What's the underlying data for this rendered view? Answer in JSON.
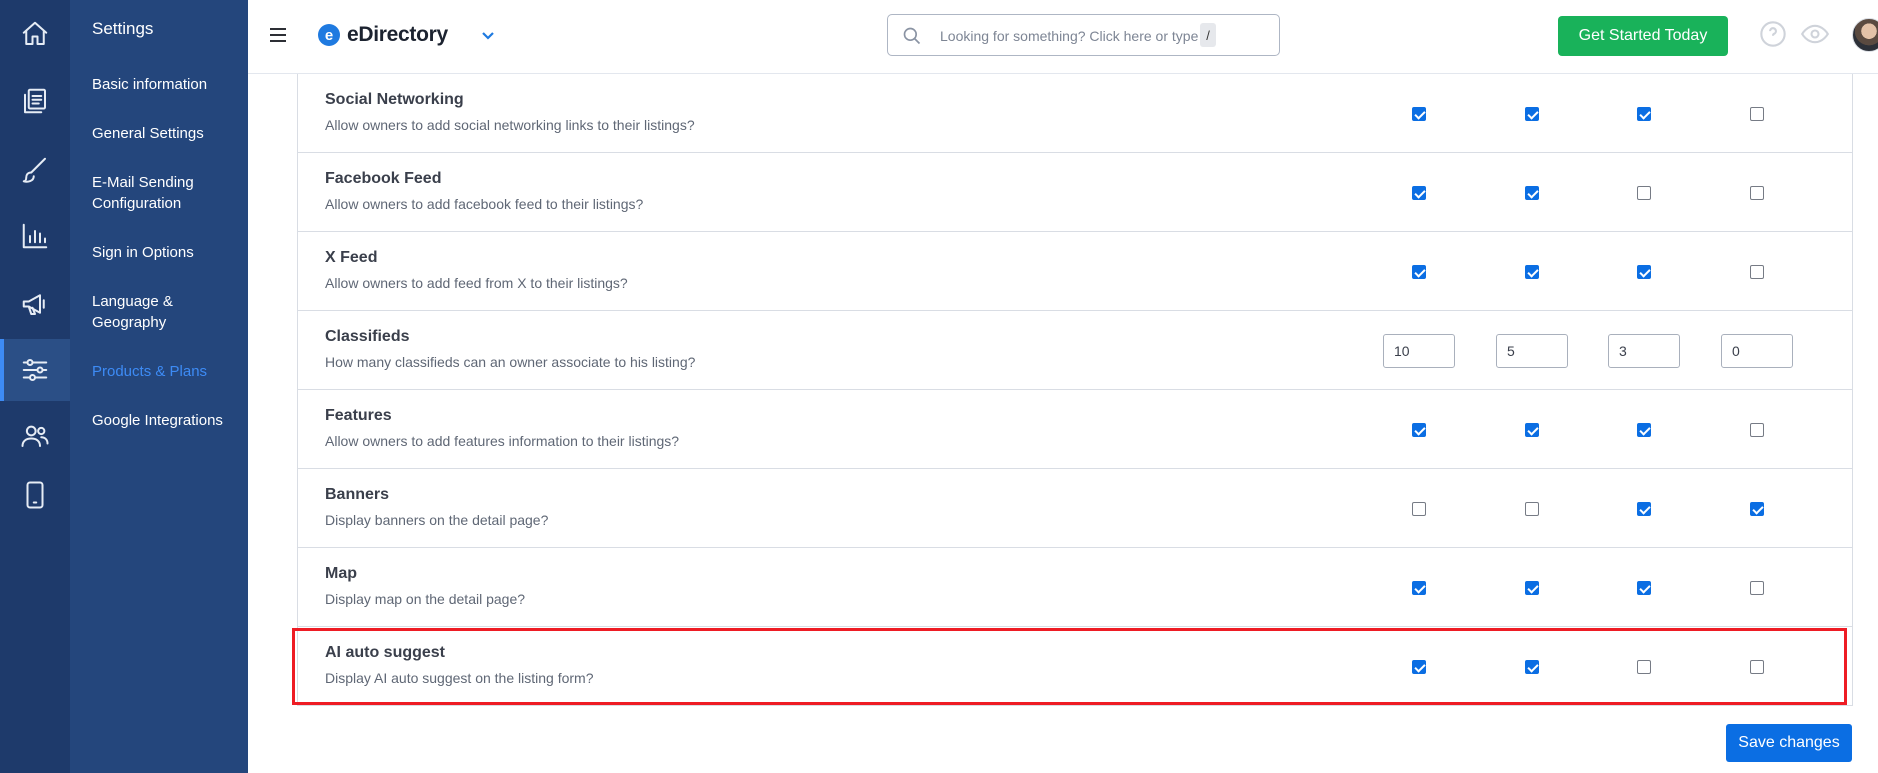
{
  "rail": {
    "icons": [
      "home-icon",
      "documents-icon",
      "brush-icon",
      "chart-icon",
      "megaphone-icon",
      "sliders-icon",
      "users-icon",
      "mobile-icon"
    ],
    "active": "sliders-icon"
  },
  "sidebar": {
    "title": "Settings",
    "items": [
      {
        "label": "Basic information"
      },
      {
        "label": "General Settings"
      },
      {
        "label": "E-Mail Sending Configuration"
      },
      {
        "label": "Sign in Options"
      },
      {
        "label": "Language & Geography"
      },
      {
        "label": "Products & Plans",
        "active": true
      },
      {
        "label": "Google Integrations"
      }
    ]
  },
  "header": {
    "logo_letter": "e",
    "logo_text": "eDirectory",
    "search_placeholder": "Looking for something? Click here or type",
    "search_shortcut": "/",
    "cta_label": "Get Started Today"
  },
  "features": [
    {
      "title": "Social Networking",
      "desc": "Allow owners to add social networking links to their listings?",
      "type": "checkbox",
      "values": [
        true,
        true,
        true,
        false
      ]
    },
    {
      "title": "Facebook Feed",
      "desc": "Allow owners to add facebook feed to their listings?",
      "type": "checkbox",
      "values": [
        true,
        true,
        false,
        false
      ]
    },
    {
      "title": "X Feed",
      "desc": "Allow owners to add feed from X to their listings?",
      "type": "checkbox",
      "values": [
        true,
        true,
        true,
        false
      ]
    },
    {
      "title": "Classifieds",
      "desc": "How many classifieds can an owner associate to his listing?",
      "type": "number",
      "values": [
        "10",
        "5",
        "3",
        "0"
      ]
    },
    {
      "title": "Features",
      "desc": "Allow owners to add features information to their listings?",
      "type": "checkbox",
      "values": [
        true,
        true,
        true,
        false
      ]
    },
    {
      "title": "Banners",
      "desc": "Display banners on the detail page?",
      "type": "checkbox",
      "values": [
        false,
        false,
        true,
        true
      ]
    },
    {
      "title": "Map",
      "desc": "Display map on the detail page?",
      "type": "checkbox",
      "values": [
        true,
        true,
        true,
        false
      ]
    },
    {
      "title": "AI auto suggest",
      "desc": "Display AI auto suggest on the listing form?",
      "type": "checkbox",
      "values": [
        true,
        true,
        false,
        false
      ],
      "highlighted": true
    }
  ],
  "save_label": "Save changes",
  "colors": {
    "rail_bg": "#1e3a6b",
    "sidebar_bg": "#24467c",
    "accent": "#0b6ee3",
    "cta_green": "#19b25a",
    "highlight_red": "#ee1c24"
  }
}
